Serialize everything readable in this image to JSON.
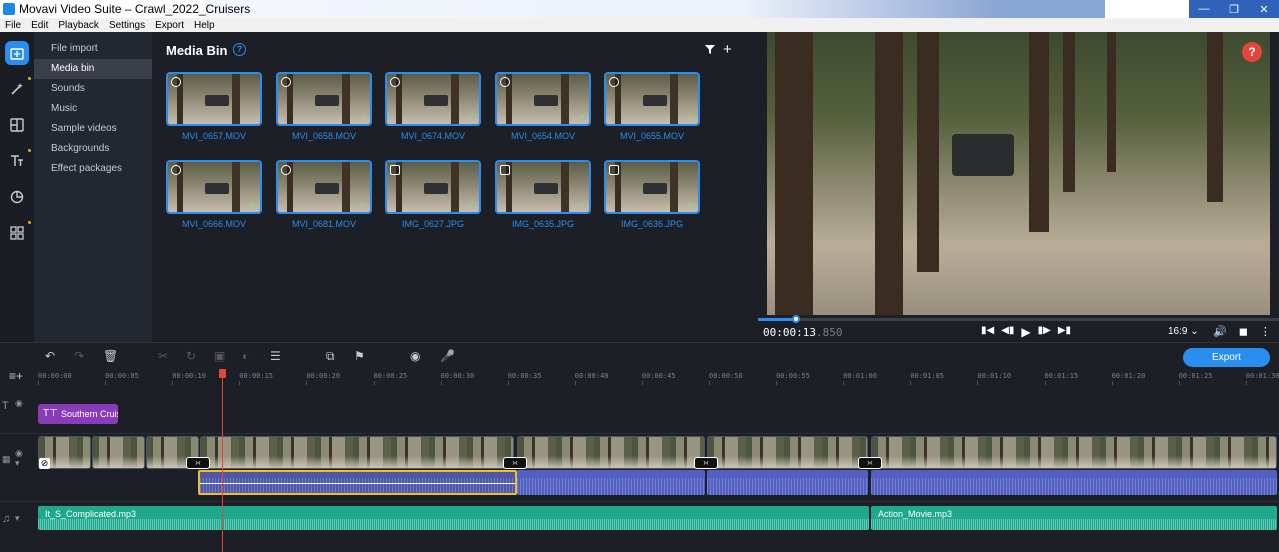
{
  "window": {
    "title": "Movavi Video Suite – Crawl_2022_Cruisers"
  },
  "menu": [
    "File",
    "Edit",
    "Playback",
    "Settings",
    "Export",
    "Help"
  ],
  "sidebar_icons": [
    "import-icon",
    "magic-wand-icon",
    "transitions-icon",
    "titles-icon",
    "stickers-icon",
    "more-tools-icon"
  ],
  "nav": {
    "items": [
      {
        "label": "File import",
        "active": false
      },
      {
        "label": "Media bin",
        "active": true
      },
      {
        "label": "Sounds",
        "active": false
      },
      {
        "label": "Music",
        "active": false
      },
      {
        "label": "Sample videos",
        "active": false
      },
      {
        "label": "Backgrounds",
        "active": false
      },
      {
        "label": "Effect packages",
        "active": false
      }
    ]
  },
  "media_bin": {
    "title": "Media Bin",
    "help": "?",
    "add": "+",
    "items": [
      {
        "name": "MVI_0657.MOV",
        "type": "video",
        "added": false
      },
      {
        "name": "MVI_0658.MOV",
        "type": "video",
        "added": true
      },
      {
        "name": "MVI_0674.MOV",
        "type": "video",
        "added": true
      },
      {
        "name": "MVI_0654.MOV",
        "type": "video",
        "added": true
      },
      {
        "name": "MVI_0655.MOV",
        "type": "video",
        "added": true
      },
      {
        "name": "MVI_0666.MOV",
        "type": "video",
        "added": true
      },
      {
        "name": "MVI_0681.MOV",
        "type": "video",
        "added": true
      },
      {
        "name": "IMG_0627.JPG",
        "type": "photo",
        "added": true
      },
      {
        "name": "IMG_0635.JPG",
        "type": "photo",
        "added": true
      },
      {
        "name": "IMG_0636.JPG",
        "type": "photo",
        "added": true
      }
    ]
  },
  "player": {
    "timecode": "00:00:13",
    "timecode_ms": ".850",
    "aspect": "16:9 ⌄",
    "help": "?",
    "progress": 0.073
  },
  "toolbar": {
    "export_label": "Export"
  },
  "ruler": [
    "00:00:00",
    "00:00:05",
    "00:00:10",
    "00:00:15",
    "00:00:20",
    "00:00:25",
    "00:00:30",
    "00:00:35",
    "00:00:40",
    "00:00:45",
    "00:00:50",
    "00:00:55",
    "00:01:00",
    "00:01:05",
    "00:01:10",
    "00:01:15",
    "00:01:20",
    "00:01:25",
    "00:01:30"
  ],
  "timeline": {
    "title_clip": "Southern Cruisers",
    "music_clips": [
      "It_S_Complicated.mp3",
      "Action_Movie.mp3"
    ]
  }
}
